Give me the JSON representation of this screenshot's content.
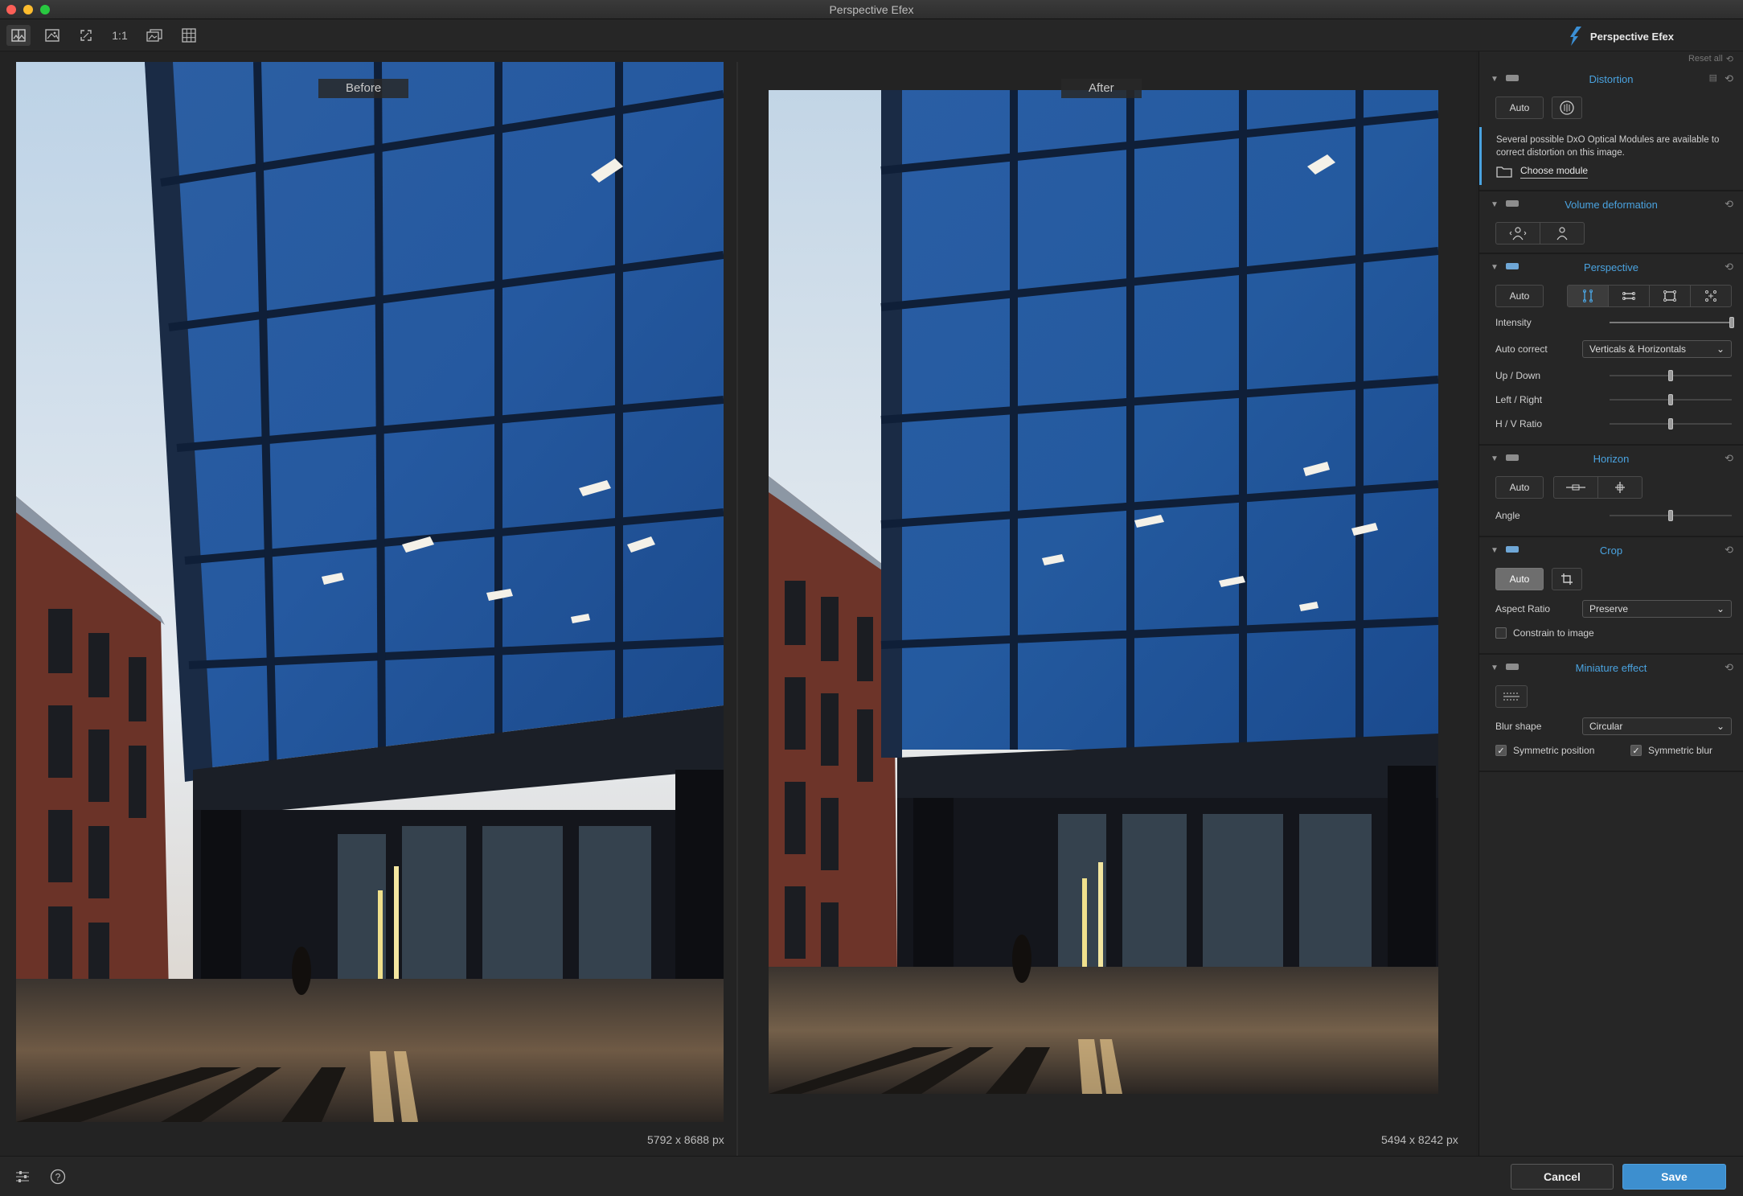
{
  "window": {
    "title": "Perspective Efex"
  },
  "toolbar": {
    "tools": [
      "split-view-icon",
      "single-image-icon",
      "fit-screen-icon",
      "zoom-1to1",
      "compare-icon",
      "grid-icon"
    ],
    "zoom_label": "1:1",
    "brand": "Perspective Efex"
  },
  "viewer": {
    "before_label": "Before",
    "after_label": "After",
    "before_size": "5792 x 8688 px",
    "after_size": "5494 x 8242 px"
  },
  "panel": {
    "reset_all": "Reset all",
    "distortion": {
      "title": "Distortion",
      "auto": "Auto",
      "info": "Several possible DxO Optical Modules are available to correct distortion on this image.",
      "choose_module": "Choose module"
    },
    "volume": {
      "title": "Volume deformation"
    },
    "perspective": {
      "title": "Perspective",
      "auto": "Auto",
      "intensity_label": "Intensity",
      "intensity_value": 1.0,
      "auto_correct_label": "Auto correct",
      "auto_correct_value": "Verticals & Horizontals",
      "updown_label": "Up / Down",
      "updown_value": 0.5,
      "leftright_label": "Left / Right",
      "leftright_value": 0.5,
      "hv_label": "H / V Ratio",
      "hv_value": 0.5
    },
    "horizon": {
      "title": "Horizon",
      "auto": "Auto",
      "angle_label": "Angle",
      "angle_value": 0.5
    },
    "crop": {
      "title": "Crop",
      "auto": "Auto",
      "aspect_label": "Aspect Ratio",
      "aspect_value": "Preserve",
      "constrain_label": "Constrain to image",
      "constrain_checked": false
    },
    "miniature": {
      "title": "Miniature effect",
      "blur_label": "Blur shape",
      "blur_value": "Circular",
      "sym_position_label": "Symmetric position",
      "sym_position_checked": true,
      "sym_blur_label": "Symmetric blur",
      "sym_blur_checked": true
    }
  },
  "footer": {
    "cancel": "Cancel",
    "save": "Save"
  },
  "colors": {
    "accent": "#4aa3e0",
    "save": "#3d8fcf",
    "glass": "#1f4f8f"
  }
}
